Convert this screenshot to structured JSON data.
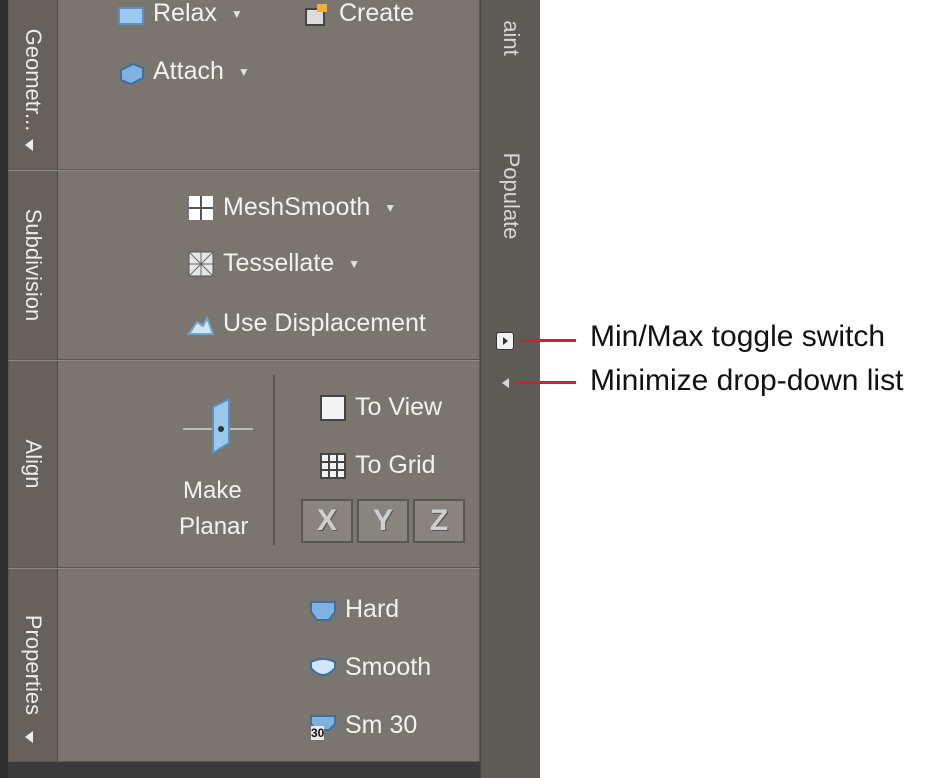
{
  "panels": {
    "geometry": {
      "title": "Geometr...",
      "tools": {
        "relax": "Relax",
        "create": "Create",
        "attach": "Attach"
      }
    },
    "subdivision": {
      "title": "Subdivision",
      "tools": {
        "meshsmooth": "MeshSmooth",
        "tessellate": "Tessellate",
        "use_displacement": "Use Displacement"
      }
    },
    "align": {
      "title": "Align",
      "tools": {
        "make": "Make",
        "planar": "Planar",
        "to_view": "To View",
        "to_grid": "To Grid",
        "x": "X",
        "y": "Y",
        "z": "Z"
      }
    },
    "properties": {
      "title": "Properties",
      "tools": {
        "hard": "Hard",
        "smooth": "Smooth",
        "sm30": "Sm 30",
        "sm30_badge": "30"
      }
    }
  },
  "side_tabs": {
    "paint": "aint",
    "populate": "Populate"
  },
  "callouts": {
    "toggle": "Min/Max toggle switch",
    "minimize": "Minimize drop-down list"
  },
  "colors": {
    "callout": "#d11f3b",
    "panel": "#7b7570",
    "text": "#f2f2f2"
  },
  "icons": {
    "relax": "relax-icon",
    "create": "create-icon",
    "attach": "attach-icon",
    "meshsmooth": "meshsmooth-icon",
    "tessellate": "tessellate-icon",
    "displacement": "displacement-icon",
    "make_planar": "make-planar-icon",
    "to_view": "to-view-icon",
    "to_grid": "to-grid-icon",
    "hard": "hard-icon",
    "smooth": "smooth-icon",
    "sm30": "sm30-icon"
  }
}
